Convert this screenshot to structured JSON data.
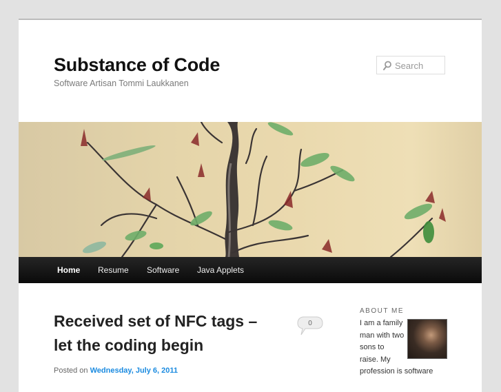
{
  "site": {
    "title": "Substance of Code",
    "description": "Software Artisan Tommi Laukkanen"
  },
  "search": {
    "placeholder": "Search",
    "icon": "search-icon"
  },
  "header_image": {
    "alt": "Bonsai tree with green and red leaves"
  },
  "nav": {
    "items": [
      {
        "label": "Home",
        "current": true
      },
      {
        "label": "Resume"
      },
      {
        "label": "Software"
      },
      {
        "label": "Java Applets"
      }
    ]
  },
  "post": {
    "title": "Received set of NFC tags – let the coding begin",
    "meta_prefix": "Posted on",
    "date": "Wednesday, July 6, 2011",
    "comment_count": "0",
    "comment_icon": "speech-bubble-icon"
  },
  "sidebar": {
    "widget_title": "ABOUT ME",
    "about_text": "I am a family man with two sons to raise. My profession is software",
    "photo": "author-photo"
  },
  "colors": {
    "background": "#e2e2e2",
    "nav_bar": "#222222",
    "link": "#1b8be0",
    "title": "#111111"
  }
}
